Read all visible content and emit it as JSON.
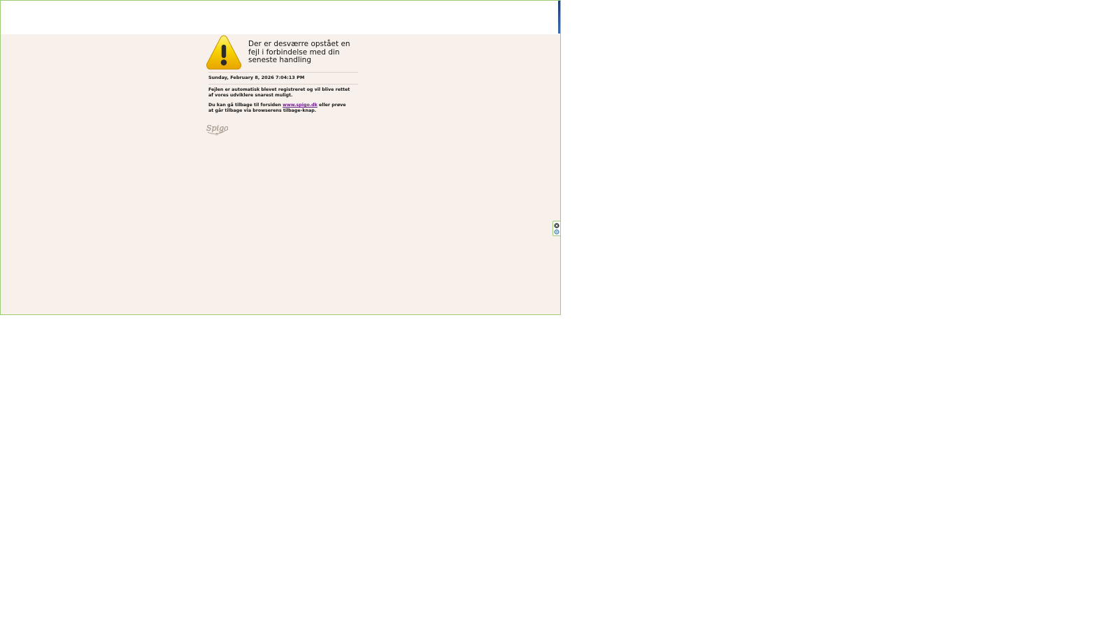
{
  "error_page": {
    "headline": "Der er desværre opstået en fejl i forbindelse med din seneste handling",
    "timestamp": "Sunday, February 8, 2026 7:04:13 PM",
    "paragraph1": "Fejlen er automatisk blevet registreret og vil blive rettet af vores udviklere snarest muligt.",
    "paragraph2_before": "Du kan gå tilbage til forsiden ",
    "link_text": "www.spigo.dk",
    "paragraph2_after": " eller prøve at går tilbage via browserens tilbage-knap."
  },
  "logo": {
    "text": "Spigo"
  },
  "icons": {
    "warning": "warning-triangle-icon",
    "close": "close-icon",
    "settings": "settings-icon"
  },
  "colors": {
    "page_background": "#f8f1eb",
    "frame_border": "#9ccc77",
    "warning_yellow": "#f5c800",
    "link": "#6a1b8a"
  }
}
